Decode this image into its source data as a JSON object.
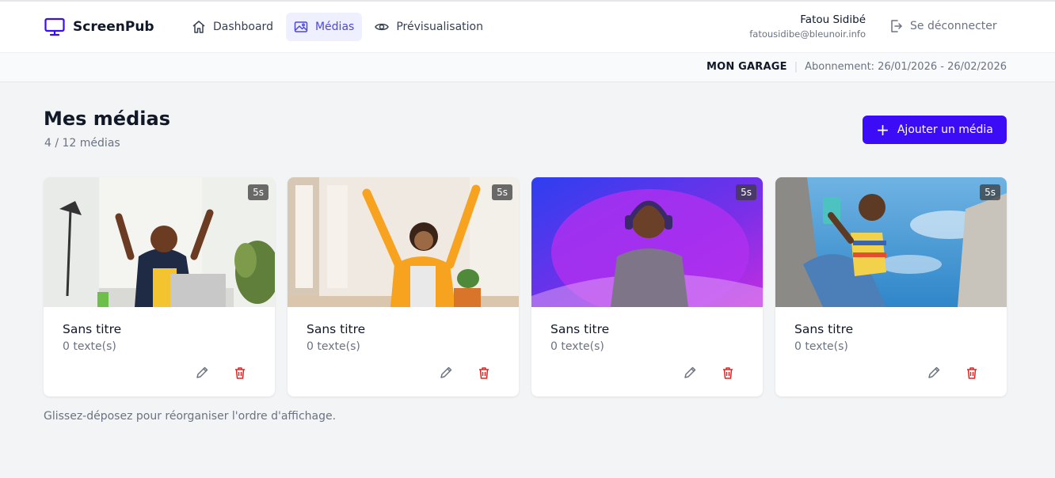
{
  "brand": {
    "name": "ScreenPub",
    "accent": "#3b0cf5"
  },
  "nav": [
    {
      "label": "Dashboard",
      "icon": "home-icon",
      "active": false
    },
    {
      "label": "Médias",
      "icon": "image-icon",
      "active": true
    },
    {
      "label": "Prévisualisation",
      "icon": "eye-icon",
      "active": false
    }
  ],
  "user": {
    "name": "Fatou Sidibé",
    "email": "fatousidibe@bleunoir.info"
  },
  "logout_label": "Se déconnecter",
  "subbar": {
    "garage": "MON GARAGE",
    "separator": "|",
    "subscription": "Abonnement: 26/01/2026 - 26/02/2026"
  },
  "page": {
    "title": "Mes médias",
    "count": "4 / 12 médias",
    "add_label": "Ajouter un média",
    "hint": "Glissez-déposez pour réorganiser l'ordre d'affichage."
  },
  "cards": [
    {
      "duration": "5s",
      "title": "Sans titre",
      "texts": "0 texte(s)"
    },
    {
      "duration": "5s",
      "title": "Sans titre",
      "texts": "0 texte(s)"
    },
    {
      "duration": "5s",
      "title": "Sans titre",
      "texts": "0 texte(s)"
    },
    {
      "duration": "5s",
      "title": "Sans titre",
      "texts": "0 texte(s)"
    }
  ]
}
